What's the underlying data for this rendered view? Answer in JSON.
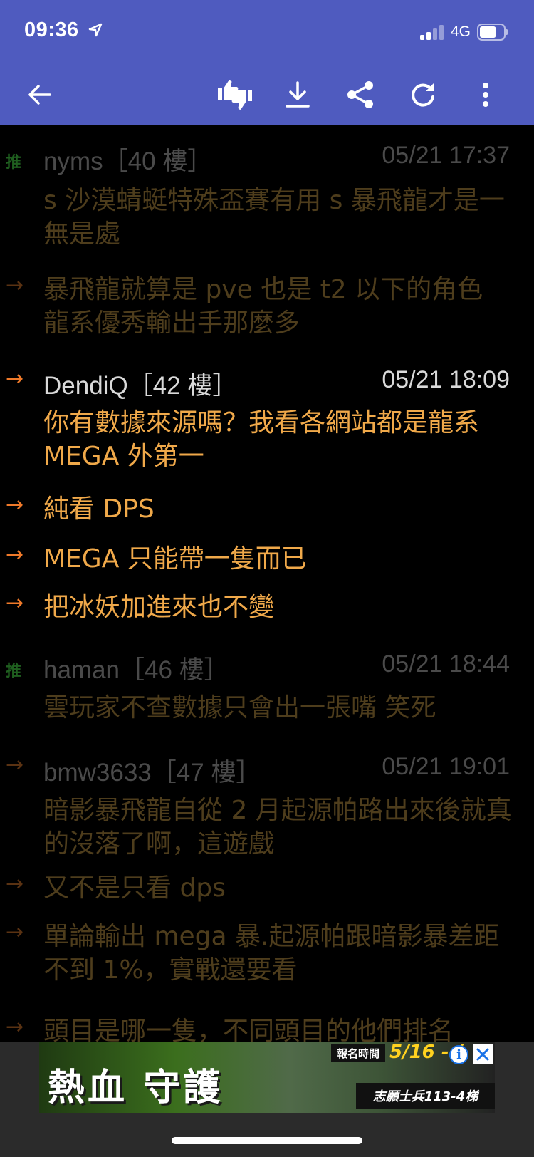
{
  "status_bar": {
    "time": "09:36",
    "network": "4G",
    "battery_percent": 70
  },
  "toolbar": {
    "icons": [
      "back-arrow-icon",
      "thumbs-up-down-icon",
      "download-icon",
      "share-icon",
      "refresh-icon",
      "more-vert-icon"
    ]
  },
  "posts": [
    {
      "prefix": "推",
      "user": "nyms［40 樓］",
      "time": "05/21 17:37",
      "text": "s 沙漠蜻蜓特殊盃賽有用 s 暴飛龍才是一無是處",
      "style": "dim"
    },
    {
      "prefix": "→",
      "text": "暴飛龍就算是 pve 也是 t2 以下的角色 龍系優秀輸出手那麼多",
      "style": "dim"
    },
    {
      "prefix": "→",
      "user": "DendiQ［42 樓］",
      "time": "05/21 18:09",
      "text": "你有數據來源嗎？我看各網站都是龍系 MEGA 外第一",
      "style": "hi"
    },
    {
      "prefix": "→",
      "text": "純看 DPS",
      "style": "hi"
    },
    {
      "prefix": "→",
      "text": "MEGA 只能帶一隻而已",
      "style": "hi"
    },
    {
      "prefix": "→",
      "text": "把冰妖加進來也不變",
      "style": "hi"
    },
    {
      "prefix": "推",
      "user": "haman［46 樓］",
      "time": "05/21 18:44",
      "text": "雲玩家不查數據只會出一張嘴 笑死",
      "style": "dim"
    },
    {
      "prefix": "→",
      "user": "bmw3633［47 樓］",
      "time": "05/21 19:01",
      "text": "暗影暴飛龍自從 2 月起源帕路出來後就真的沒落了啊，這遊戲",
      "style": "dim"
    },
    {
      "prefix": "→",
      "text": "又不是只看 dps",
      "style": "dim"
    },
    {
      "prefix": "→",
      "text": "單論輸出 mega 暴.起源帕跟暗影暴差距不到 1%，實戰還要看",
      "style": "dim"
    },
    {
      "prefix": "→",
      "text": "頭目是哪一隻，不同頭目的他們排名",
      "style": "dim"
    }
  ],
  "ad": {
    "title": "熱血 守護",
    "badge": "報名時間",
    "date": "5/16 - (",
    "bottom": "志願士兵113-4梯",
    "info_label": "i"
  }
}
